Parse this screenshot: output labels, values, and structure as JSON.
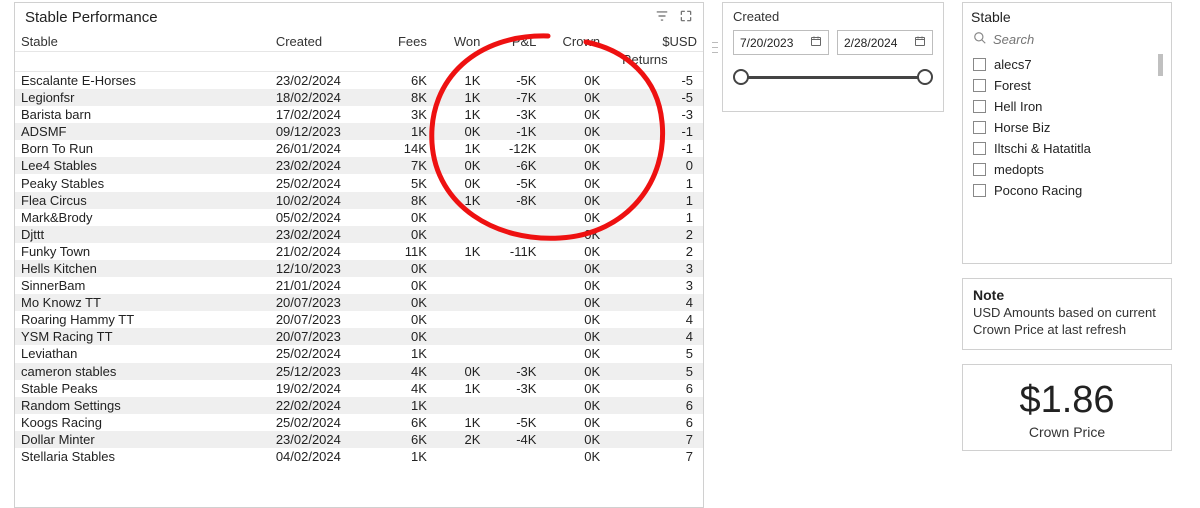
{
  "table": {
    "title": "Stable Performance",
    "columns": [
      "Stable",
      "Created",
      "Fees",
      "Won",
      "P&L",
      "Crown",
      "$USD"
    ],
    "subcolumn_returns": "Returns",
    "rows": [
      {
        "stable": "Escalante E-Horses",
        "created": "23/02/2024",
        "fees": "6K",
        "won": "1K",
        "pl": "-5K",
        "crown": "0K",
        "usd": "-5"
      },
      {
        "stable": "Legionfsr",
        "created": "18/02/2024",
        "fees": "8K",
        "won": "1K",
        "pl": "-7K",
        "crown": "0K",
        "usd": "-5"
      },
      {
        "stable": "Barista barn",
        "created": "17/02/2024",
        "fees": "3K",
        "won": "1K",
        "pl": "-3K",
        "crown": "0K",
        "usd": "-3"
      },
      {
        "stable": "ADSMF",
        "created": "09/12/2023",
        "fees": "1K",
        "won": "0K",
        "pl": "-1K",
        "crown": "0K",
        "usd": "-1"
      },
      {
        "stable": "Born To Run",
        "created": "26/01/2024",
        "fees": "14K",
        "won": "1K",
        "pl": "-12K",
        "crown": "0K",
        "usd": "-1"
      },
      {
        "stable": "Lee4 Stables",
        "created": "23/02/2024",
        "fees": "7K",
        "won": "0K",
        "pl": "-6K",
        "crown": "0K",
        "usd": "0"
      },
      {
        "stable": "Peaky Stables",
        "created": "25/02/2024",
        "fees": "5K",
        "won": "0K",
        "pl": "-5K",
        "crown": "0K",
        "usd": "1"
      },
      {
        "stable": "Flea Circus",
        "created": "10/02/2024",
        "fees": "8K",
        "won": "1K",
        "pl": "-8K",
        "crown": "0K",
        "usd": "1"
      },
      {
        "stable": "Mark&Brody",
        "created": "05/02/2024",
        "fees": "0K",
        "won": "",
        "pl": "",
        "crown": "0K",
        "usd": "1"
      },
      {
        "stable": "Djttt",
        "created": "23/02/2024",
        "fees": "0K",
        "won": "",
        "pl": "",
        "crown": "0K",
        "usd": "2"
      },
      {
        "stable": "Funky Town",
        "created": "21/02/2024",
        "fees": "11K",
        "won": "1K",
        "pl": "-11K",
        "crown": "0K",
        "usd": "2"
      },
      {
        "stable": "Hells Kitchen",
        "created": "12/10/2023",
        "fees": "0K",
        "won": "",
        "pl": "",
        "crown": "0K",
        "usd": "3"
      },
      {
        "stable": "SinnerBam",
        "created": "21/01/2024",
        "fees": "0K",
        "won": "",
        "pl": "",
        "crown": "0K",
        "usd": "3"
      },
      {
        "stable": "Mo Knowz TT",
        "created": "20/07/2023",
        "fees": "0K",
        "won": "",
        "pl": "",
        "crown": "0K",
        "usd": "4"
      },
      {
        "stable": "Roaring Hammy TT",
        "created": "20/07/2023",
        "fees": "0K",
        "won": "",
        "pl": "",
        "crown": "0K",
        "usd": "4"
      },
      {
        "stable": "YSM Racing TT",
        "created": "20/07/2023",
        "fees": "0K",
        "won": "",
        "pl": "",
        "crown": "0K",
        "usd": "4"
      },
      {
        "stable": "Leviathan",
        "created": "25/02/2024",
        "fees": "1K",
        "won": "",
        "pl": "",
        "crown": "0K",
        "usd": "5"
      },
      {
        "stable": "cameron stables",
        "created": "25/12/2023",
        "fees": "4K",
        "won": "0K",
        "pl": "-3K",
        "crown": "0K",
        "usd": "5"
      },
      {
        "stable": "Stable Peaks",
        "created": "19/02/2024",
        "fees": "4K",
        "won": "1K",
        "pl": "-3K",
        "crown": "0K",
        "usd": "6"
      },
      {
        "stable": "Random Settings",
        "created": "22/02/2024",
        "fees": "1K",
        "won": "",
        "pl": "",
        "crown": "0K",
        "usd": "6"
      },
      {
        "stable": "Koogs Racing",
        "created": "25/02/2024",
        "fees": "6K",
        "won": "1K",
        "pl": "-5K",
        "crown": "0K",
        "usd": "6"
      },
      {
        "stable": "Dollar Minter",
        "created": "23/02/2024",
        "fees": "6K",
        "won": "2K",
        "pl": "-4K",
        "crown": "0K",
        "usd": "7"
      },
      {
        "stable": "Stellaria Stables",
        "created": "04/02/2024",
        "fees": "1K",
        "won": "",
        "pl": "",
        "crown": "0K",
        "usd": "7"
      }
    ]
  },
  "dateSlicer": {
    "title": "Created",
    "start": "7/20/2023",
    "end": "2/28/2024"
  },
  "stableSlicer": {
    "title": "Stable",
    "searchPlaceholder": "Search",
    "items": [
      "alecs7",
      "Forest",
      "Hell Iron",
      "Horse Biz",
      "Iltschi & Hatatitla",
      "medopts",
      "Pocono Racing"
    ]
  },
  "note": {
    "title": "Note",
    "text": "USD Amounts based on current Crown Price at last refresh"
  },
  "price": {
    "value": "$1.86",
    "label": "Crown Price"
  }
}
